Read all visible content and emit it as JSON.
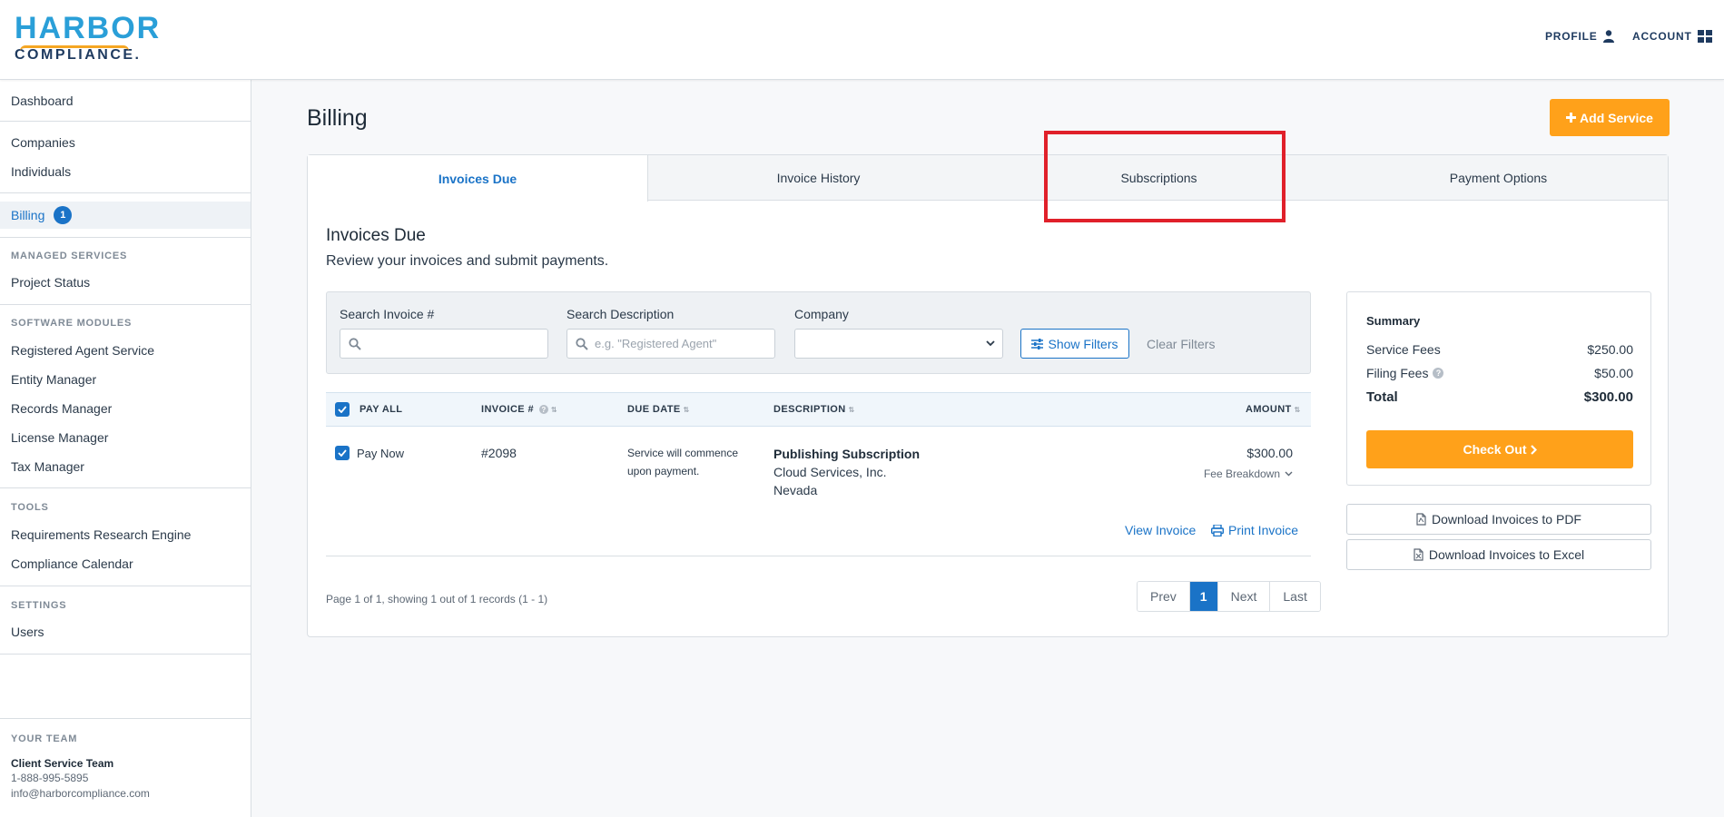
{
  "header": {
    "logo_top": "HARBOR",
    "logo_bottom": "COMPLIANCE.",
    "profile_label": "PROFILE",
    "account_label": "ACCOUNT"
  },
  "sidebar": {
    "dashboard": "Dashboard",
    "companies": "Companies",
    "individuals": "Individuals",
    "billing": "Billing",
    "billing_badge": "1",
    "managed_services_heading": "MANAGED SERVICES",
    "project_status": "Project Status",
    "software_modules_heading": "SOFTWARE MODULES",
    "registered_agent_service": "Registered Agent Service",
    "entity_manager": "Entity Manager",
    "records_manager": "Records Manager",
    "license_manager": "License Manager",
    "tax_manager": "Tax Manager",
    "tools_heading": "TOOLS",
    "requirements_research_engine": "Requirements Research Engine",
    "compliance_calendar": "Compliance Calendar",
    "settings_heading": "SETTINGS",
    "users": "Users",
    "your_team_heading": "YOUR TEAM",
    "team_name": "Client Service Team",
    "team_phone": "1-888-995-5895",
    "team_email": "info@harborcompliance.com"
  },
  "main": {
    "title": "Billing",
    "add_service": "Add Service",
    "tabs": {
      "invoices_due": "Invoices Due",
      "invoice_history": "Invoice History",
      "subscriptions": "Subscriptions",
      "payment_options": "Payment Options"
    },
    "section_title": "Invoices Due",
    "section_subtitle": "Review your invoices and submit payments.",
    "filters": {
      "search_invoice_label": "Search Invoice #",
      "search_invoice_value": "",
      "search_description_label": "Search Description",
      "search_description_placeholder": "e.g. \"Registered Agent\"",
      "company_label": "Company",
      "company_value": "",
      "show_filters": "Show Filters",
      "clear_filters": "Clear Filters"
    },
    "table": {
      "headers": {
        "pay_all": "PAY ALL",
        "invoice_num": "INVOICE #",
        "due_date": "DUE DATE",
        "description": "DESCRIPTION",
        "amount": "AMOUNT"
      },
      "row": {
        "pay_now": "Pay Now",
        "invoice_num": "#2098",
        "due_line1": "Service will commence",
        "due_line2": "upon payment.",
        "description_title": "Publishing Subscription",
        "description_company": "Cloud Services, Inc.",
        "description_state": "Nevada",
        "amount": "$300.00",
        "fee_breakdown": "Fee Breakdown",
        "view_invoice": "View Invoice",
        "print_invoice": "Print Invoice"
      }
    },
    "pagination": {
      "info": "Page 1 of 1, showing 1 out of 1 records (1 - 1)",
      "prev": "Prev",
      "current": "1",
      "next": "Next",
      "last": "Last"
    },
    "summary": {
      "title": "Summary",
      "service_fees_label": "Service Fees",
      "service_fees_value": "$250.00",
      "filing_fees_label": "Filing Fees",
      "filing_fees_value": "$50.00",
      "total_label": "Total",
      "total_value": "$300.00",
      "checkout": "Check Out"
    },
    "downloads": {
      "pdf": "Download Invoices to PDF",
      "excel": "Download Invoices to Excel"
    }
  },
  "colors": {
    "brand_blue": "#1a73c7",
    "accent_orange": "#ffa11a",
    "highlight_red": "#e0202a"
  }
}
